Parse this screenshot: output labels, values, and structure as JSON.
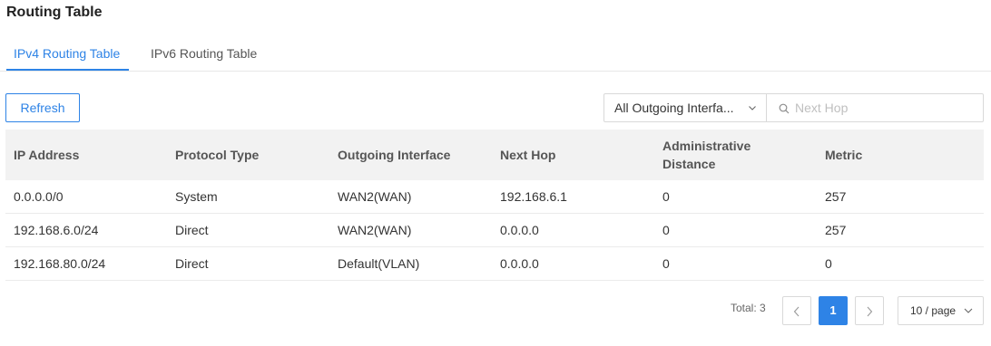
{
  "page": {
    "title": "Routing Table"
  },
  "tabs": [
    {
      "label": "IPv4 Routing Table",
      "active": true
    },
    {
      "label": "IPv6 Routing Table",
      "active": false
    }
  ],
  "toolbar": {
    "refresh_label": "Refresh",
    "interface_filter": {
      "value": "All Outgoing Interfa...",
      "icon": "chevron-down-icon"
    },
    "search": {
      "placeholder": "Next Hop",
      "value": "",
      "icon": "search-icon"
    }
  },
  "table": {
    "columns": [
      "IP Address",
      "Protocol Type",
      "Outgoing Interface",
      "Next Hop",
      "Administrative Distance",
      "Metric"
    ],
    "rows": [
      [
        "0.0.0.0/0",
        "System",
        "WAN2(WAN)",
        "192.168.6.1",
        "0",
        "257"
      ],
      [
        "192.168.6.0/24",
        "Direct",
        "WAN2(WAN)",
        "0.0.0.0",
        "0",
        "257"
      ],
      [
        "192.168.80.0/24",
        "Direct",
        "Default(VLAN)",
        "0.0.0.0",
        "0",
        "0"
      ]
    ]
  },
  "pagination": {
    "total_label": "Total: 3",
    "current_page": "1",
    "page_size": "10 / page"
  },
  "colors": {
    "accent": "#2e83e6",
    "header_bg": "#f2f2f2",
    "border": "#d9d9d9"
  }
}
